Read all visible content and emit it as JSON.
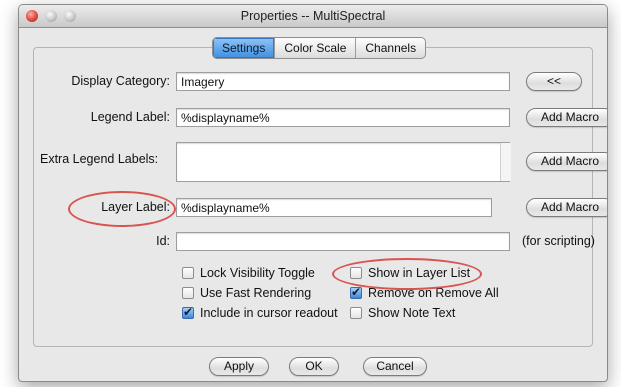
{
  "window": {
    "title": "Properties -- MultiSpectral"
  },
  "tabs": [
    {
      "label": "Settings",
      "active": true
    },
    {
      "label": "Color Scale",
      "active": false
    },
    {
      "label": "Channels",
      "active": false
    }
  ],
  "form": {
    "display_category": {
      "label": "Display Category:",
      "value": "Imagery",
      "button": "<<"
    },
    "legend_label": {
      "label": "Legend Label:",
      "value": "%displayname%",
      "button": "Add Macro"
    },
    "extra_legend_labels": {
      "label": "Extra Legend Labels:",
      "value": "",
      "button": "Add Macro"
    },
    "layer_label": {
      "label": "Layer Label:",
      "value": "%displayname%",
      "button": "Add Macro"
    },
    "id": {
      "label": "Id:",
      "value": "",
      "note": "(for scripting)"
    }
  },
  "checkboxes": [
    {
      "label": "Lock Visibility Toggle",
      "checked": false
    },
    {
      "label": "Use Fast Rendering",
      "checked": false
    },
    {
      "label": "Include in cursor readout",
      "checked": true
    },
    {
      "label": "Show in Layer List",
      "checked": false
    },
    {
      "label": "Remove on Remove All",
      "checked": true
    },
    {
      "label": "Show Note Text",
      "checked": false
    }
  ],
  "footer": {
    "apply": "Apply",
    "ok": "OK",
    "cancel": "Cancel"
  },
  "colors": {
    "highlight_ring": "#d9534f",
    "accent": "#3f8fe0"
  }
}
